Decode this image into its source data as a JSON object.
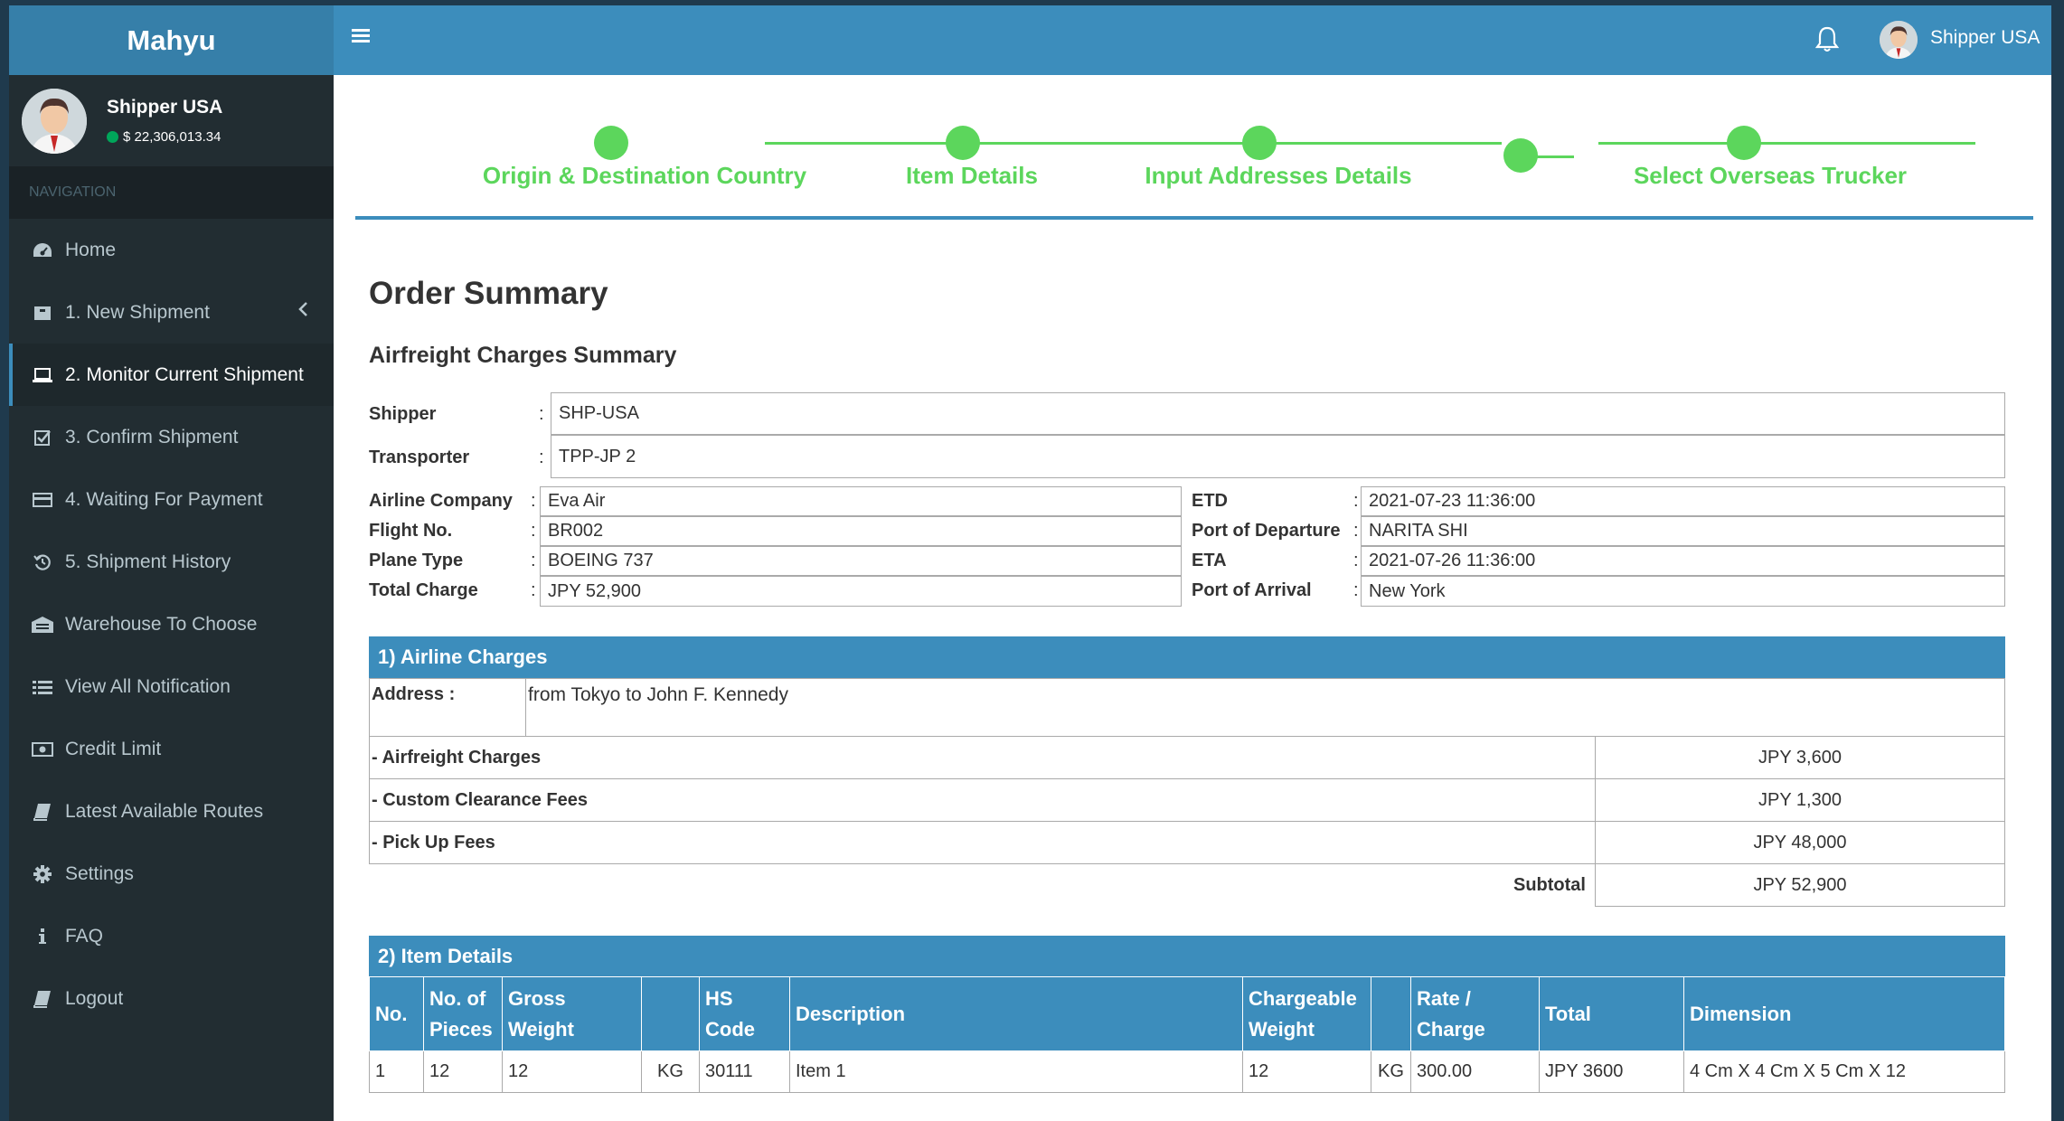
{
  "app": {
    "logo": "Mahyu",
    "user_name": "Shipper USA",
    "balance": "$ 22,306,013.34"
  },
  "sidebar": {
    "header": "NAVIGATION",
    "items": [
      {
        "label": "Home",
        "icon": "dashboard-icon"
      },
      {
        "label": "1. New Shipment",
        "icon": "box-icon"
      },
      {
        "label": "2. Monitor Current Shipment",
        "icon": "laptop-icon"
      },
      {
        "label": "3. Confirm Shipment",
        "icon": "checkbox-icon"
      },
      {
        "label": "4. Waiting For Payment",
        "icon": "credit-card-icon"
      },
      {
        "label": "5. Shipment History",
        "icon": "history-icon"
      },
      {
        "label": "Warehouse To Choose",
        "icon": "warehouse-icon"
      },
      {
        "label": "View All Notification",
        "icon": "list-icon"
      },
      {
        "label": "Credit Limit",
        "icon": "money-icon"
      },
      {
        "label": "Latest Available Routes",
        "icon": "book-icon"
      },
      {
        "label": "Settings",
        "icon": "gear-icon"
      },
      {
        "label": "FAQ",
        "icon": "info-icon"
      },
      {
        "label": "Logout",
        "icon": "book-icon"
      }
    ]
  },
  "header": {
    "user_name": "Shipper USA"
  },
  "stepper": {
    "steps": [
      "Origin & Destination Country",
      "Item Details",
      "Input Addresses Details",
      "",
      "Select Overseas Trucker"
    ]
  },
  "main": {
    "title": "Order Summary",
    "subtitle": "Airfreight Charges Summary",
    "shipper_label": "Shipper",
    "shipper": "SHP-USA",
    "transporter_label": "Transporter",
    "transporter": "TPP-JP 2",
    "left_fields": [
      {
        "label": "Airline Company",
        "value": "Eva Air"
      },
      {
        "label": "Flight No.",
        "value": "BR002"
      },
      {
        "label": "Plane Type",
        "value": "BOEING 737"
      },
      {
        "label": "Total Charge",
        "value": "JPY 52,900"
      }
    ],
    "right_fields": [
      {
        "label": "ETD",
        "value": "2021-07-23 11:36:00"
      },
      {
        "label": "Port of Departure",
        "value": "NARITA SHI"
      },
      {
        "label": "ETA",
        "value": "2021-07-26 11:36:00"
      },
      {
        "label": "Port of Arrival",
        "value": "New York"
      }
    ],
    "colon": ":"
  },
  "airline_charges": {
    "title": "1) Airline Charges",
    "address_label": "Address :",
    "address": "from Tokyo to John F. Kennedy",
    "rows": [
      {
        "label": "- Airfreight Charges",
        "value": "JPY 3,600"
      },
      {
        "label": "- Custom Clearance Fees",
        "value": "JPY 1,300"
      },
      {
        "label": "- Pick Up Fees",
        "value": "JPY 48,000"
      }
    ],
    "subtotal_label": "Subtotal",
    "subtotal": "JPY 52,900"
  },
  "item_details": {
    "title": "2) Item Details",
    "headers": [
      "No.",
      "No. of Pieces",
      "Gross Weight",
      "",
      "HS Code",
      "Description",
      "Chargeable Weight",
      "",
      "Rate / Charge",
      "Total",
      "Dimension"
    ],
    "rows": [
      [
        "1",
        "12",
        "12",
        "KG",
        "30111",
        "Item 1",
        "12",
        "KG",
        "300.00",
        "JPY 3600",
        "4 Cm X 4 Cm X 5 Cm X 12"
      ]
    ]
  }
}
